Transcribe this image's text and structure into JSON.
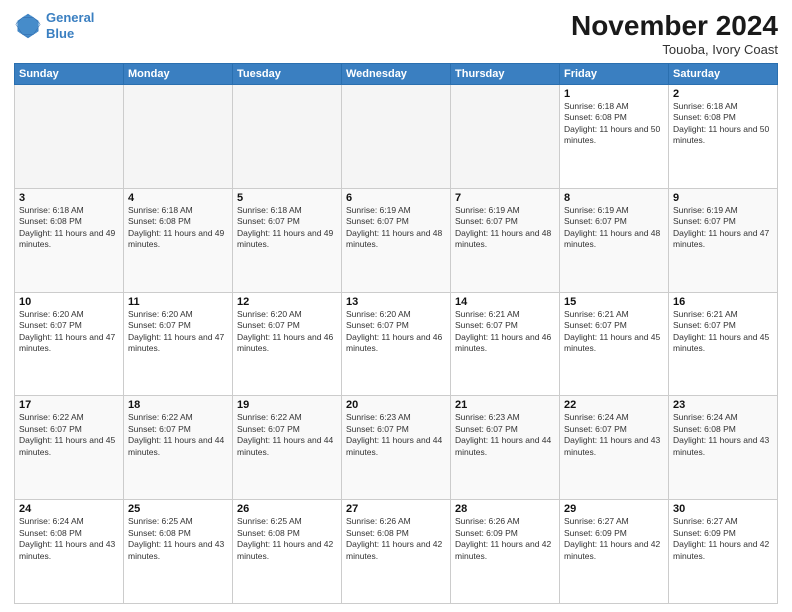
{
  "header": {
    "logo_line1": "General",
    "logo_line2": "Blue",
    "month_title": "November 2024",
    "location": "Touoba, Ivory Coast"
  },
  "weekdays": [
    "Sunday",
    "Monday",
    "Tuesday",
    "Wednesday",
    "Thursday",
    "Friday",
    "Saturday"
  ],
  "weeks": [
    [
      {
        "day": "",
        "empty": true
      },
      {
        "day": "",
        "empty": true
      },
      {
        "day": "",
        "empty": true
      },
      {
        "day": "",
        "empty": true
      },
      {
        "day": "",
        "empty": true
      },
      {
        "day": "1",
        "sunrise": "Sunrise: 6:18 AM",
        "sunset": "Sunset: 6:08 PM",
        "daylight": "Daylight: 11 hours and 50 minutes."
      },
      {
        "day": "2",
        "sunrise": "Sunrise: 6:18 AM",
        "sunset": "Sunset: 6:08 PM",
        "daylight": "Daylight: 11 hours and 50 minutes."
      }
    ],
    [
      {
        "day": "3",
        "sunrise": "Sunrise: 6:18 AM",
        "sunset": "Sunset: 6:08 PM",
        "daylight": "Daylight: 11 hours and 49 minutes."
      },
      {
        "day": "4",
        "sunrise": "Sunrise: 6:18 AM",
        "sunset": "Sunset: 6:08 PM",
        "daylight": "Daylight: 11 hours and 49 minutes."
      },
      {
        "day": "5",
        "sunrise": "Sunrise: 6:18 AM",
        "sunset": "Sunset: 6:07 PM",
        "daylight": "Daylight: 11 hours and 49 minutes."
      },
      {
        "day": "6",
        "sunrise": "Sunrise: 6:19 AM",
        "sunset": "Sunset: 6:07 PM",
        "daylight": "Daylight: 11 hours and 48 minutes."
      },
      {
        "day": "7",
        "sunrise": "Sunrise: 6:19 AM",
        "sunset": "Sunset: 6:07 PM",
        "daylight": "Daylight: 11 hours and 48 minutes."
      },
      {
        "day": "8",
        "sunrise": "Sunrise: 6:19 AM",
        "sunset": "Sunset: 6:07 PM",
        "daylight": "Daylight: 11 hours and 48 minutes."
      },
      {
        "day": "9",
        "sunrise": "Sunrise: 6:19 AM",
        "sunset": "Sunset: 6:07 PM",
        "daylight": "Daylight: 11 hours and 47 minutes."
      }
    ],
    [
      {
        "day": "10",
        "sunrise": "Sunrise: 6:20 AM",
        "sunset": "Sunset: 6:07 PM",
        "daylight": "Daylight: 11 hours and 47 minutes."
      },
      {
        "day": "11",
        "sunrise": "Sunrise: 6:20 AM",
        "sunset": "Sunset: 6:07 PM",
        "daylight": "Daylight: 11 hours and 47 minutes."
      },
      {
        "day": "12",
        "sunrise": "Sunrise: 6:20 AM",
        "sunset": "Sunset: 6:07 PM",
        "daylight": "Daylight: 11 hours and 46 minutes."
      },
      {
        "day": "13",
        "sunrise": "Sunrise: 6:20 AM",
        "sunset": "Sunset: 6:07 PM",
        "daylight": "Daylight: 11 hours and 46 minutes."
      },
      {
        "day": "14",
        "sunrise": "Sunrise: 6:21 AM",
        "sunset": "Sunset: 6:07 PM",
        "daylight": "Daylight: 11 hours and 46 minutes."
      },
      {
        "day": "15",
        "sunrise": "Sunrise: 6:21 AM",
        "sunset": "Sunset: 6:07 PM",
        "daylight": "Daylight: 11 hours and 45 minutes."
      },
      {
        "day": "16",
        "sunrise": "Sunrise: 6:21 AM",
        "sunset": "Sunset: 6:07 PM",
        "daylight": "Daylight: 11 hours and 45 minutes."
      }
    ],
    [
      {
        "day": "17",
        "sunrise": "Sunrise: 6:22 AM",
        "sunset": "Sunset: 6:07 PM",
        "daylight": "Daylight: 11 hours and 45 minutes."
      },
      {
        "day": "18",
        "sunrise": "Sunrise: 6:22 AM",
        "sunset": "Sunset: 6:07 PM",
        "daylight": "Daylight: 11 hours and 44 minutes."
      },
      {
        "day": "19",
        "sunrise": "Sunrise: 6:22 AM",
        "sunset": "Sunset: 6:07 PM",
        "daylight": "Daylight: 11 hours and 44 minutes."
      },
      {
        "day": "20",
        "sunrise": "Sunrise: 6:23 AM",
        "sunset": "Sunset: 6:07 PM",
        "daylight": "Daylight: 11 hours and 44 minutes."
      },
      {
        "day": "21",
        "sunrise": "Sunrise: 6:23 AM",
        "sunset": "Sunset: 6:07 PM",
        "daylight": "Daylight: 11 hours and 44 minutes."
      },
      {
        "day": "22",
        "sunrise": "Sunrise: 6:24 AM",
        "sunset": "Sunset: 6:07 PM",
        "daylight": "Daylight: 11 hours and 43 minutes."
      },
      {
        "day": "23",
        "sunrise": "Sunrise: 6:24 AM",
        "sunset": "Sunset: 6:08 PM",
        "daylight": "Daylight: 11 hours and 43 minutes."
      }
    ],
    [
      {
        "day": "24",
        "sunrise": "Sunrise: 6:24 AM",
        "sunset": "Sunset: 6:08 PM",
        "daylight": "Daylight: 11 hours and 43 minutes."
      },
      {
        "day": "25",
        "sunrise": "Sunrise: 6:25 AM",
        "sunset": "Sunset: 6:08 PM",
        "daylight": "Daylight: 11 hours and 43 minutes."
      },
      {
        "day": "26",
        "sunrise": "Sunrise: 6:25 AM",
        "sunset": "Sunset: 6:08 PM",
        "daylight": "Daylight: 11 hours and 42 minutes."
      },
      {
        "day": "27",
        "sunrise": "Sunrise: 6:26 AM",
        "sunset": "Sunset: 6:08 PM",
        "daylight": "Daylight: 11 hours and 42 minutes."
      },
      {
        "day": "28",
        "sunrise": "Sunrise: 6:26 AM",
        "sunset": "Sunset: 6:09 PM",
        "daylight": "Daylight: 11 hours and 42 minutes."
      },
      {
        "day": "29",
        "sunrise": "Sunrise: 6:27 AM",
        "sunset": "Sunset: 6:09 PM",
        "daylight": "Daylight: 11 hours and 42 minutes."
      },
      {
        "day": "30",
        "sunrise": "Sunrise: 6:27 AM",
        "sunset": "Sunset: 6:09 PM",
        "daylight": "Daylight: 11 hours and 42 minutes."
      }
    ]
  ]
}
